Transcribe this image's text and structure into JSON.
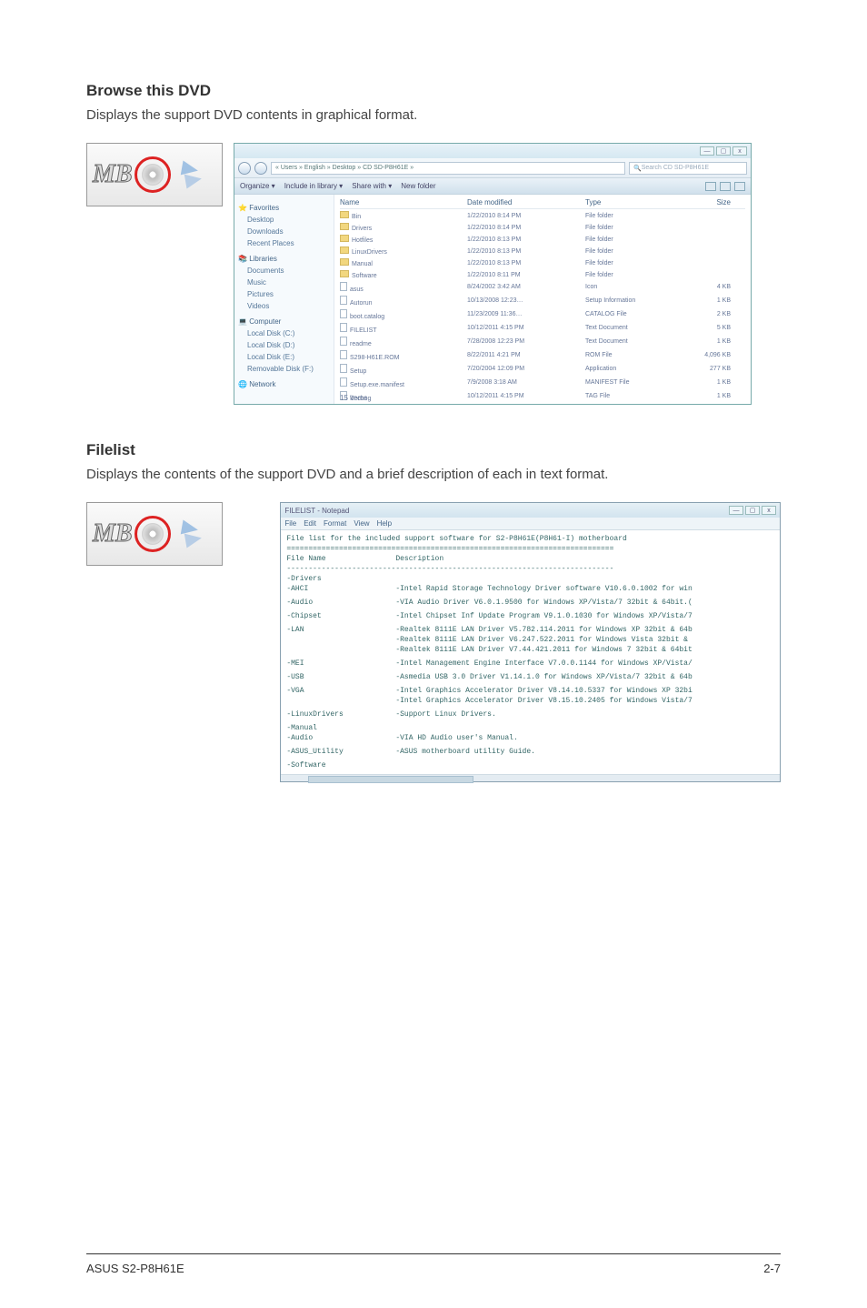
{
  "section1": {
    "heading": "Browse this DVD",
    "desc": "Displays the support DVD contents in graphical format."
  },
  "section2": {
    "heading": "Filelist",
    "desc": "Displays the contents of the support DVD and a brief description of each in text format."
  },
  "explorer": {
    "address": "« Users » English » Desktop » CD SD-P8H61E »",
    "search": "Search CD SD-P8H61E",
    "toolbar": {
      "organize": "Organize ▾",
      "include": "Include in library ▾",
      "share": "Share with ▾",
      "newfolder": "New folder"
    },
    "winbtns": {
      "min": "—",
      "max": "▢",
      "close": "x"
    },
    "side": {
      "fav": "Favorites",
      "desk": "Desktop",
      "down": "Downloads",
      "recent": "Recent Places",
      "lib": "Libraries",
      "docs": "Documents",
      "music": "Music",
      "pics": "Pictures",
      "vids": "Videos",
      "comp": "Computer",
      "disk_c": "Local Disk (C:)",
      "disk_d": "Local Disk (D:)",
      "disk_e": "Local Disk (E:)",
      "remov": "Removable Disk (F:)",
      "net": "Network"
    },
    "headers": {
      "name": "Name",
      "date": "Date modified",
      "type": "Type",
      "size": "Size"
    },
    "rows": [
      {
        "name": "Bin",
        "date": "1/22/2010 8:14 PM",
        "type": "File folder",
        "size": ""
      },
      {
        "name": "Drivers",
        "date": "1/22/2010 8:14 PM",
        "type": "File folder",
        "size": ""
      },
      {
        "name": "Hotfiles",
        "date": "1/22/2010 8:13 PM",
        "type": "File folder",
        "size": ""
      },
      {
        "name": "LinuxDrivers",
        "date": "1/22/2010 8:13 PM",
        "type": "File folder",
        "size": ""
      },
      {
        "name": "Manual",
        "date": "1/22/2010 8:13 PM",
        "type": "File folder",
        "size": ""
      },
      {
        "name": "Software",
        "date": "1/22/2010 8:11 PM",
        "type": "File folder",
        "size": ""
      },
      {
        "name": "asus",
        "date": "8/24/2002 3:42 AM",
        "type": "Icon",
        "size": "4 KB"
      },
      {
        "name": "Autorun",
        "date": "10/13/2008 12:23…",
        "type": "Setup Information",
        "size": "1 KB"
      },
      {
        "name": "boot.catalog",
        "date": "11/23/2009 11:36…",
        "type": "CATALOG File",
        "size": "2 KB"
      },
      {
        "name": "FILELIST",
        "date": "10/12/2011 4:15 PM",
        "type": "Text Document",
        "size": "5 KB"
      },
      {
        "name": "readme",
        "date": "7/28/2008 12:23 PM",
        "type": "Text Document",
        "size": "1 KB"
      },
      {
        "name": "S298-H61E.ROM",
        "date": "8/22/2011 4:21 PM",
        "type": "ROM File",
        "size": "4,096 KB"
      },
      {
        "name": "Setup",
        "date": "7/20/2004 12:09 PM",
        "type": "Application",
        "size": "277 KB"
      },
      {
        "name": "Setup.exe.manifest",
        "date": "7/9/2008 3:18 AM",
        "type": "MANIFEST File",
        "size": "1 KB"
      },
      {
        "name": "Vecbeg",
        "date": "10/12/2011 4:15 PM",
        "type": "TAG File",
        "size": "1 KB"
      }
    ],
    "statusbar": "15 items"
  },
  "notepad": {
    "title": "FILELIST - Notepad",
    "menu": {
      "file": "File",
      "edit": "Edit",
      "format": "Format",
      "view": "View",
      "help": "Help"
    },
    "header_line": "File list for the included support software for S2-P8H61E(P8H61-I) motherboard",
    "col1": "File Name",
    "col2": "Description",
    "items": [
      {
        "k": "-Drivers",
        "v": ""
      },
      {
        "k": "  -AHCI",
        "v": "-Intel Rapid Storage Technology Driver software V10.6.0.1002 for win"
      },
      {
        "k": "  -Audio",
        "v": "-VIA Audio Driver V6.0.1.9500 for Windows XP/Vista/7 32bit & 64bit.("
      },
      {
        "k": "  -Chipset",
        "v": "-Intel Chipset Inf Update Program V9.1.0.1030 for Windows XP/Vista/7"
      },
      {
        "k": "  -LAN",
        "v": "-Realtek 8111E LAN Driver V5.782.114.2011 for Windows XP 32bit & 64b\n-Realtek 8111E LAN Driver V6.247.522.2011 for Windows Vista 32bit &\n-Realtek 8111E LAN Driver V7.44.421.2011 for Windows 7 32bit & 64bit"
      },
      {
        "k": "  -MEI",
        "v": "-Intel Management Engine Interface V7.0.0.1144 for Windows XP/Vista/"
      },
      {
        "k": "  -USB",
        "v": "-Asmedia USB 3.0 Driver V1.14.1.0 for Windows XP/Vista/7 32bit & 64b"
      },
      {
        "k": "  -VGA",
        "v": "-Intel Graphics Accelerator Driver V8.14.10.5337 for Windows XP 32bi\n-Intel Graphics Accelerator Driver V8.15.10.2405 for Windows Vista/7"
      },
      {
        "k": "-LinuxDrivers",
        "v": "-Support Linux Drivers."
      },
      {
        "k": "-Manual",
        "v": ""
      },
      {
        "k": "  -Audio",
        "v": "-VIA HD Audio user's Manual."
      },
      {
        "k": "  -ASUS_Utility",
        "v": "-ASUS motherboard utility Guide."
      },
      {
        "k": "-Software",
        "v": ""
      }
    ]
  },
  "footer": {
    "left": "ASUS S2-P8H61E",
    "right": "2-7"
  }
}
